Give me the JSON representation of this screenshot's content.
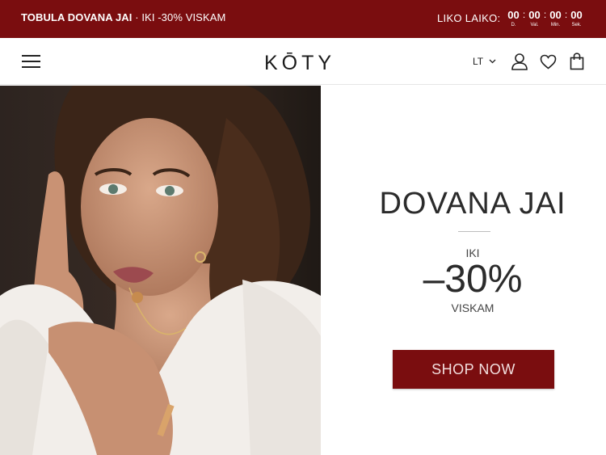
{
  "promo": {
    "bold_text": "TOBULA DOVANA JAI",
    "rest_text": " · IKI -30% VISKAM",
    "countdown_label": "LIKO LAIKO:",
    "countdown": [
      {
        "value": "00",
        "unit": "D."
      },
      {
        "value": "00",
        "unit": "Val."
      },
      {
        "value": "00",
        "unit": "Min."
      },
      {
        "value": "00",
        "unit": "Sek."
      }
    ]
  },
  "header": {
    "logo": "KŌTY",
    "language": "LT"
  },
  "hero": {
    "title": "DOVANA JAI",
    "prefix": "IKI",
    "discount": "–30%",
    "suffix": "VISKAM",
    "cta": "SHOP NOW"
  },
  "colors": {
    "brand": "#7a0d0f",
    "text": "#2b2b2b",
    "background": "#ffffff"
  },
  "icons": [
    "menu-icon",
    "chevron-down-icon",
    "user-icon",
    "heart-icon",
    "shopping-bag-icon"
  ]
}
